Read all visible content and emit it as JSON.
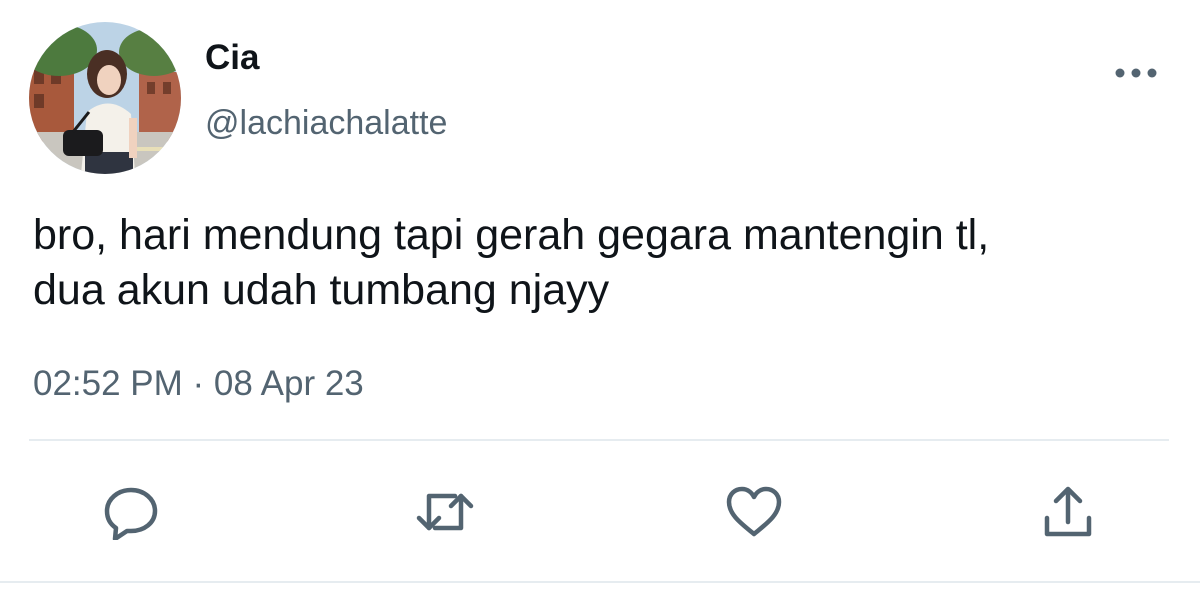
{
  "user": {
    "display_name": "Cia",
    "handle": "@lachiachalatte"
  },
  "tweet": {
    "text_lines": [
      "bro, hari mendung tapi gerah gegara mantengin tl,",
      "dua akun udah tumbang njayy"
    ],
    "timestamp": "02:52 PM · 08 Apr 23"
  },
  "actions": {
    "reply_icon": "reply-icon",
    "retweet_icon": "retweet-icon",
    "like_icon": "heart-icon",
    "share_icon": "share-icon",
    "more_icon": "more-icon"
  },
  "colors": {
    "primary_text": "#0f1419",
    "secondary_text": "#536471",
    "divider": "#e6ecf0",
    "icon": "#536471"
  }
}
